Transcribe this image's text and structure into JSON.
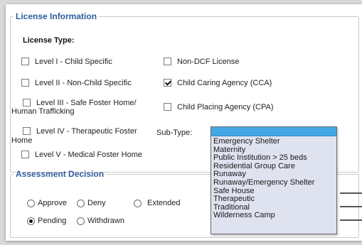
{
  "license": {
    "legend": "License Information",
    "type_label": "License Type:",
    "options_left": [
      {
        "label": "Level I - Child Specific",
        "checked": false
      },
      {
        "label": "Level II - Non-Child Specific",
        "checked": false
      },
      {
        "label_line1": "Level III - Safe Foster Home/",
        "label_line2": "Human Trafficking",
        "checked": false
      },
      {
        "label_line1": "Level IV - Therapeutic Foster",
        "label_line2": "Home",
        "checked": false
      },
      {
        "label": "Level V - Medical Foster Home",
        "checked": false
      }
    ],
    "options_right": [
      {
        "label": "Non-DCF License",
        "checked": false
      },
      {
        "label": "Child Caring Agency (CCA)",
        "checked": true
      },
      {
        "label": "Child Placing Agency (CPA)",
        "checked": false
      }
    ],
    "subtype_label": "Sub-Type:",
    "subtype_selected": "",
    "subtype_options": [
      "Emergency Shelter",
      "Maternity",
      "Public Institution > 25 beds",
      "Residential Group Care",
      "Runaway",
      "Runaway/Emergency Shelter",
      "Safe House",
      "Therapeutic",
      "Traditional",
      "Wilderness Camp"
    ]
  },
  "assessment": {
    "legend": "Assessment Decision",
    "options": [
      {
        "label": "Approve",
        "selected": false
      },
      {
        "label": "Deny",
        "selected": false
      },
      {
        "label": "Extended",
        "selected": false
      },
      {
        "label": "Pending",
        "selected": true
      },
      {
        "label": "Withdrawn",
        "selected": false
      }
    ]
  }
}
